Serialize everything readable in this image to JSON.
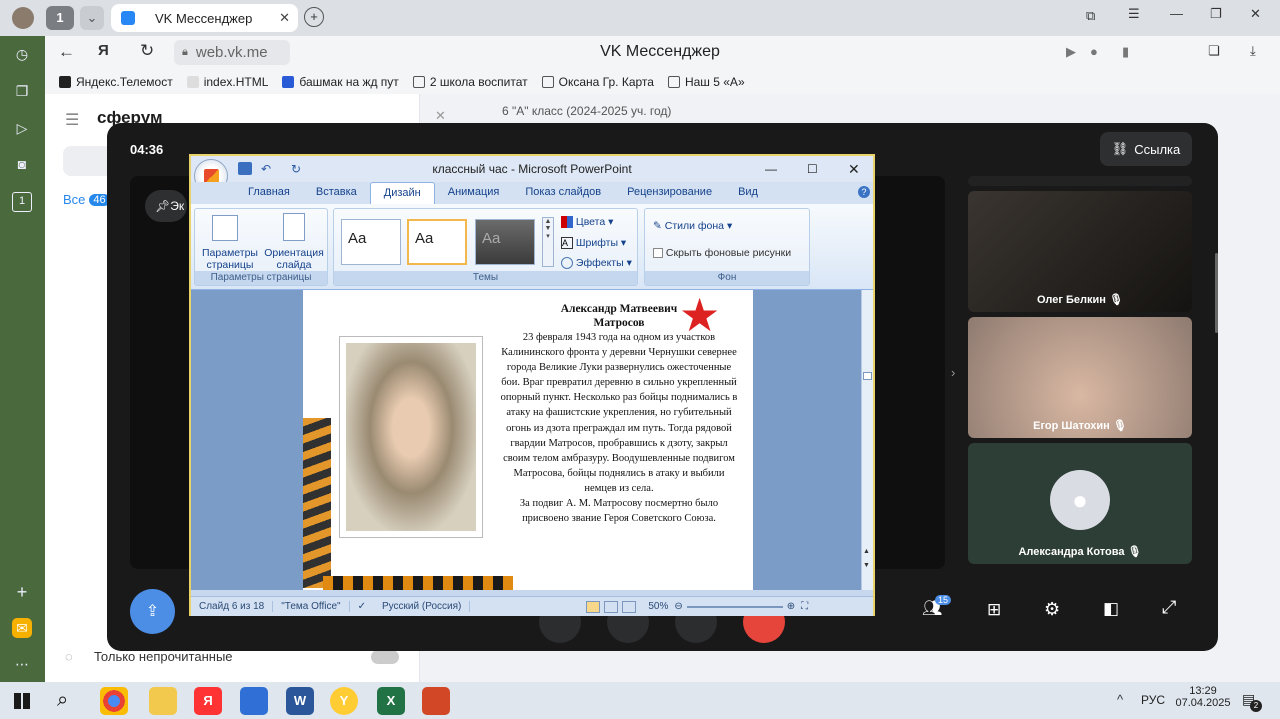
{
  "browser": {
    "tab_count": "1",
    "tab_title": "VK Мессенджер",
    "url": "web.vk.me",
    "page_title": "VK Мессенджер",
    "bookmarks": [
      "Яндекс.Телемост",
      "index.HTML",
      "башмак на жд пут",
      "2 школа воспитат",
      "Оксана Гр. Карта",
      "Наш 5 «А»"
    ]
  },
  "vk": {
    "logo": "сферум",
    "chat_title": "6 \"А\" класс (2024-2025 уч. год)",
    "filter_all": "Все",
    "filter_badge": "46",
    "unread_only": "Только непрочитанные"
  },
  "call": {
    "timer": "04:36",
    "link_button": "Ссылка",
    "pin_label": "Эк",
    "participants_badge": "15",
    "participants": [
      {
        "name": "Олег Белкин"
      },
      {
        "name": "Егор Шатохин"
      },
      {
        "name": "Александра Котова"
      }
    ]
  },
  "ppt": {
    "window_title": "классный час - Microsoft PowerPoint",
    "tabs": [
      "Главная",
      "Вставка",
      "Дизайн",
      "Анимация",
      "Показ слайдов",
      "Рецензирование",
      "Вид"
    ],
    "active_tab": "Дизайн",
    "groups": {
      "page_setup": "Параметры страницы",
      "themes": "Темы",
      "background": "Фон"
    },
    "buttons": {
      "page_params": "Параметры страницы",
      "orientation": "Ориентация слайда",
      "colors": "Цвета",
      "fonts": "Шрифты",
      "effects": "Эффекты",
      "bg_styles": "Стили фона",
      "hide_bg": "Скрыть фоновые рисунки",
      "theme_sample": "Aa"
    },
    "slide": {
      "title_line1": "Александр Матвеевич",
      "title_line2": "Матросов",
      "body": "23 февраля 1943 года на одном из участков Калининского фронта у деревни Чернушки севернее города Великие Луки развернулись ожесточенные бои. Враг превратил деревню в сильно укрепленный опорный пункт. Несколько раз бойцы поднимались в атаку на фашистские укрепления, но губительный огонь из дзота преграждал им путь. Тогда рядовой гвардии Матросов, пробравшись к дзоту, закрыл своим телом амбразуру. Воодушевленные подвигом Матросова, бойцы поднялись в атаку и выбили немцев из села.",
      "body2": "За подвиг А. М. Матросову посмертно было присвоено звание Героя Советского Союза."
    },
    "status": {
      "slide_of": "Слайд 6 из 18",
      "theme": "\"Тема Office\"",
      "language": "Русский (Россия)",
      "zoom": "50%"
    }
  },
  "taskbar": {
    "lang": "РУС",
    "time": "13:29",
    "date": "07.04.2025",
    "notif": "2"
  }
}
